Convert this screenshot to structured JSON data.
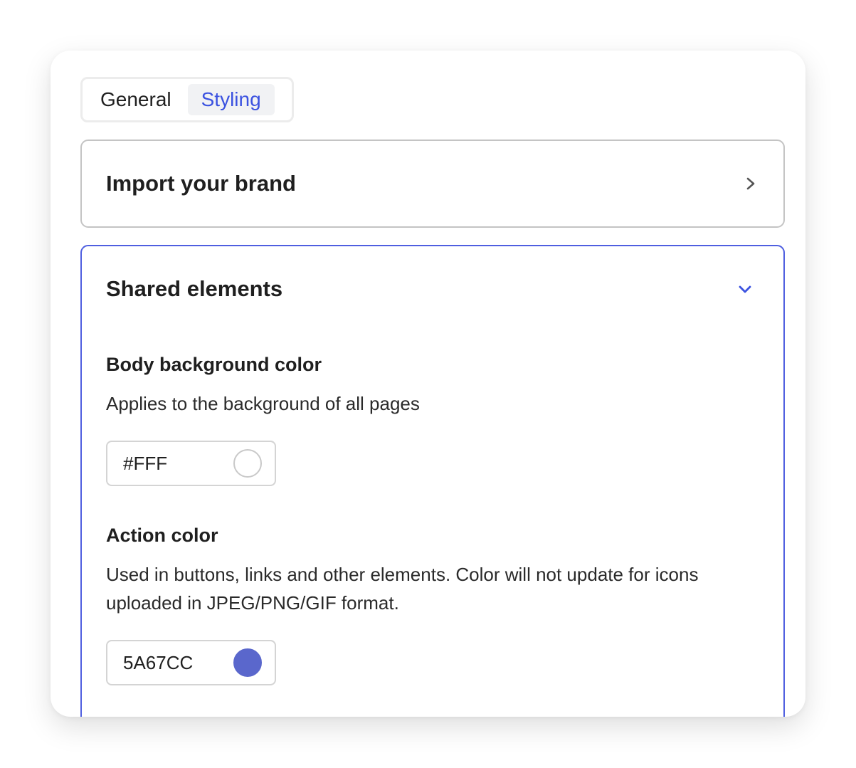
{
  "tabs": [
    {
      "label": "General",
      "active": false
    },
    {
      "label": "Styling",
      "active": true
    }
  ],
  "import_panel": {
    "title": "Import your brand",
    "icon": "chevron-right-icon",
    "expanded": false
  },
  "shared_panel": {
    "title": "Shared elements",
    "icon": "chevron-down-icon",
    "expanded": true,
    "body_background": {
      "label": "Body background color",
      "description": "Applies to the background of all pages",
      "value": "#FFF",
      "swatch_color": "#FFFFFF"
    },
    "action_color": {
      "label": "Action color",
      "description": "Used in buttons, links and other elements. Color will not update for icons uploaded in JPEG/PNG/GIF format.",
      "value": "5A67CC",
      "swatch_color": "#5A67CC"
    }
  },
  "colors": {
    "accent": "#3B52E0",
    "active_border": "#4F5FE0"
  }
}
